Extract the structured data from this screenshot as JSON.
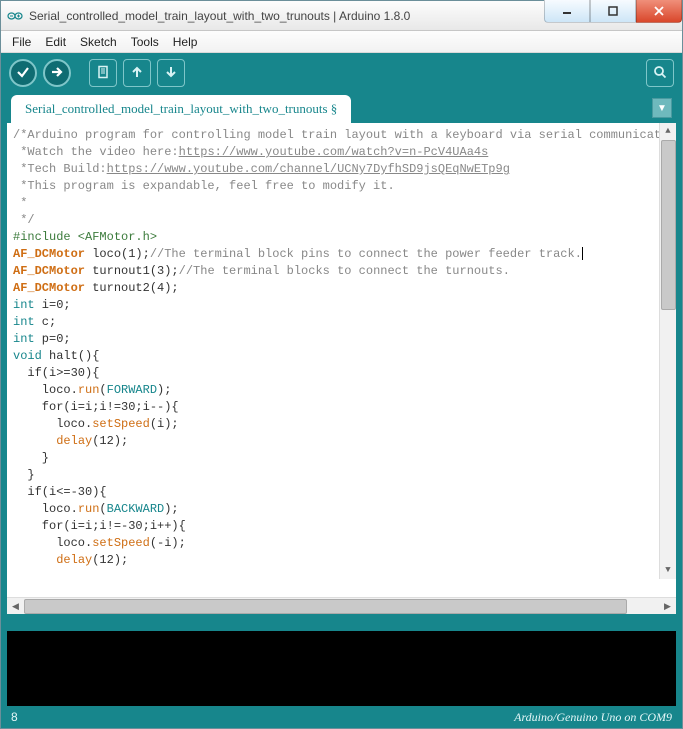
{
  "window": {
    "title": "Serial_controlled_model_train_layout_with_two_trunouts | Arduino 1.8.0"
  },
  "menu": {
    "file": "File",
    "edit": "Edit",
    "sketch": "Sketch",
    "tools": "Tools",
    "help": "Help"
  },
  "tab": {
    "label": "Serial_controlled_model_train_layout_with_two_trunouts §"
  },
  "code": {
    "l1a": "/*Arduino program for controlling model train layout with a keyboard via serial communicatio",
    "l2a": " *Watch the video here:",
    "l2b": "https://www.youtube.com/watch?v=n-PcV4UAa4s",
    "l3a": " *Tech Build:",
    "l3b": "https://www.youtube.com/channel/UCNy7DyfhSD9jsQEqNwETp9g",
    "l4": " *This program is expandable, feel free to modify it.",
    "l5": " *",
    "l6": " */",
    "l7a": "#include",
    "l7b": " <AFMotor.h>",
    "l8a": "AF_DCMotor",
    "l8b": " loco(1);",
    "l8c": "//The terminal block pins to connect the power feeder track.",
    "l9a": "AF_DCMotor",
    "l9b": " turnout1(3);",
    "l9c": "//The terminal blocks to connect the turnouts.",
    "l10a": "AF_DCMotor",
    "l10b": " turnout2(4);",
    "l11a": "int",
    "l11b": " i=0;",
    "l12a": "int",
    "l12b": " c;",
    "l13a": "int",
    "l13b": " p=0;",
    "l14a": "void",
    "l14b": " halt(){",
    "l15": "  if(i>=30){",
    "l16a": "    loco.",
    "l16b": "run",
    "l16c": "(",
    "l16d": "FORWARD",
    "l16e": ");",
    "l17": "    for(i=i;i!=30;i--){",
    "l18a": "      loco.",
    "l18b": "setSpeed",
    "l18c": "(i);",
    "l19a": "      ",
    "l19b": "delay",
    "l19c": "(12);",
    "l20": "    }",
    "l21": "  }",
    "l22": "  if(i<=-30){",
    "l23a": "    loco.",
    "l23b": "run",
    "l23c": "(",
    "l23d": "BACKWARD",
    "l23e": ");",
    "l24": "    for(i=i;i!=-30;i++){",
    "l25a": "      loco.",
    "l25b": "setSpeed",
    "l25c": "(-i);",
    "l26a": "      ",
    "l26b": "delay",
    "l26c": "(12);"
  },
  "status": {
    "line": "8",
    "board": "Arduino/Genuino Uno on COM9"
  }
}
